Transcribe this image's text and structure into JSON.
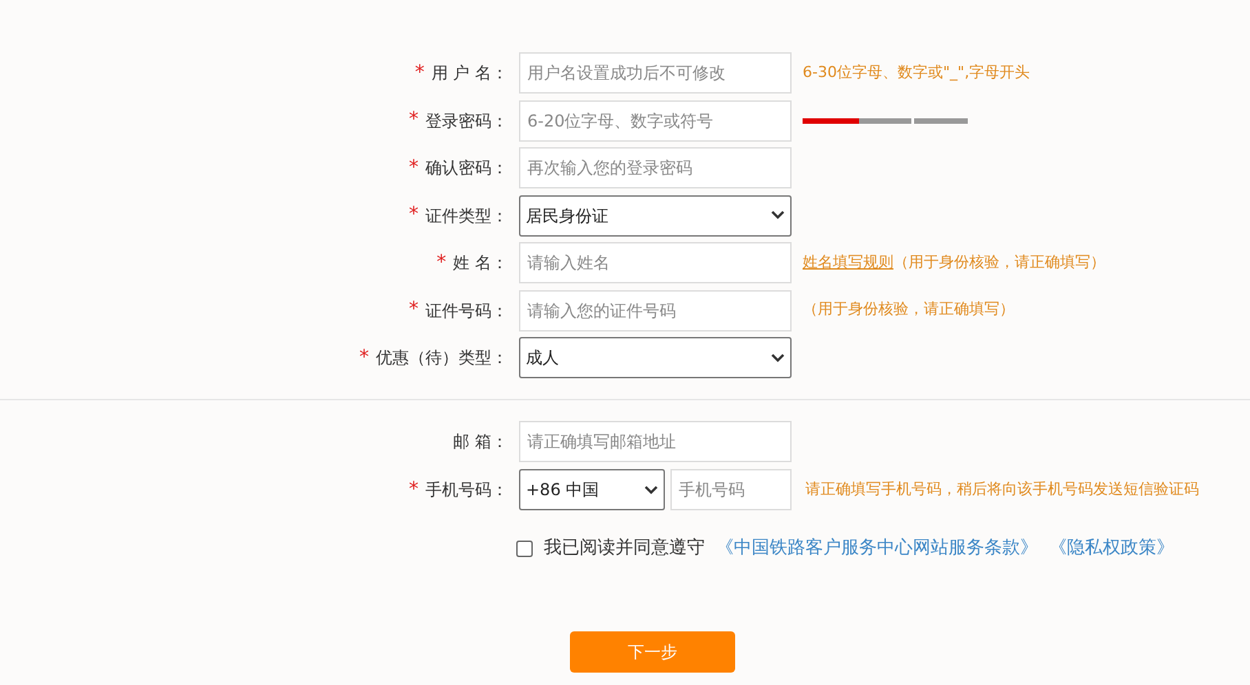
{
  "fields": [
    {
      "kind": "input",
      "mark": "*",
      "label": "用 户 名：",
      "placeholder": "用户名设置成功后不可修改",
      "hint": "6-30位字母、数字或\"_\",字母开头"
    },
    {
      "kind": "password",
      "mark": "*",
      "label": "登录密码：",
      "placeholder": "6-20位字母、数字或符号",
      "strength": {
        "level": 0.34
      }
    },
    {
      "kind": "input",
      "mark": "*",
      "label": "确认密码：",
      "placeholder": "再次输入您的登录密码"
    },
    {
      "kind": "select",
      "mark": "*",
      "label": "证件类型：",
      "value": "居民身份证"
    },
    {
      "kind": "input",
      "mark": "*",
      "label": "姓 名：",
      "placeholder": "请输入姓名",
      "link": "姓名填写规则",
      "hint": "（用于身份核验，请正确填写）"
    },
    {
      "kind": "input",
      "mark": "*",
      "label": "证件号码：",
      "placeholder": "请输入您的证件号码",
      "hint": "（用于身份核验，请正确填写）"
    },
    {
      "kind": "select",
      "mark": "*",
      "label": "优惠（待）类型：",
      "value": "成人"
    }
  ],
  "contact": [
    {
      "kind": "input",
      "label": "邮 箱：",
      "placeholder": "请正确填写邮箱地址"
    },
    {
      "kind": "phone",
      "mark": "*",
      "label": "手机号码：",
      "country": "+86 中国",
      "placeholder": "手机号码",
      "hint": "请正确填写手机号码，稍后将向该手机号码发送短信验证码"
    }
  ],
  "agreement": {
    "checked": false,
    "text": "我已阅读并同意遵守",
    "links": [
      "《中国铁路客户服务中心网站服务条款》",
      "《隐私权政策》"
    ]
  },
  "next_button": "下一步"
}
